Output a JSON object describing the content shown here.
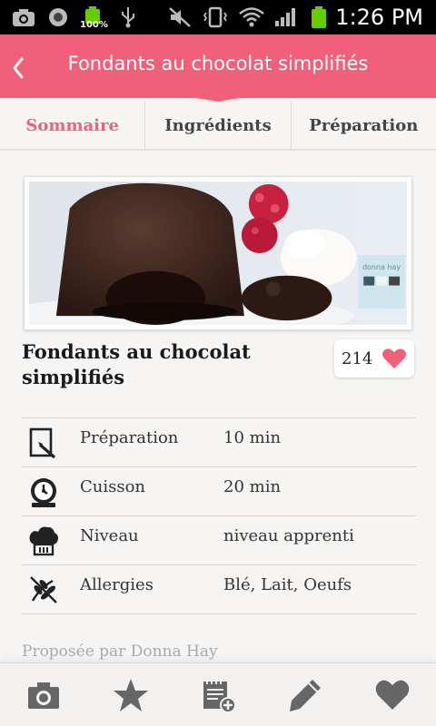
{
  "status_bar": {
    "time": "1:26 PM",
    "battery_percent": "100%"
  },
  "header": {
    "title": "Fondants au chocolat simplifiés",
    "color": "#f0607a"
  },
  "tabs": [
    {
      "label": "Sommaire",
      "active": true
    },
    {
      "label": "Ingrédients",
      "active": false
    },
    {
      "label": "Préparation",
      "active": false
    }
  ],
  "recipe": {
    "title": "Fondants au chocolat simplifiés",
    "likes": "214",
    "photo_badge": "donna hay",
    "info": [
      {
        "icon": "preparation-icon",
        "label": "Préparation",
        "value": "10 min"
      },
      {
        "icon": "timer-icon",
        "label": "Cuisson",
        "value": "20 min"
      },
      {
        "icon": "chef-hat-icon",
        "label": "Niveau",
        "value": "niveau apprenti"
      },
      {
        "icon": "allergy-icon",
        "label": "Allergies",
        "value": "Blé, Lait, Oeufs"
      }
    ],
    "proposed_by": "Proposée par Donna Hay"
  },
  "bottom_nav": [
    {
      "icon": "camera-icon"
    },
    {
      "icon": "star-icon"
    },
    {
      "icon": "add-list-icon"
    },
    {
      "icon": "pencil-icon"
    },
    {
      "icon": "heart-icon"
    }
  ]
}
